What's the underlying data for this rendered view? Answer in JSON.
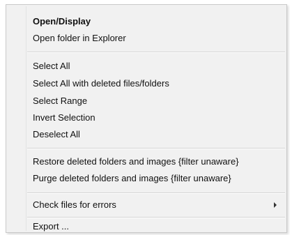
{
  "menu": {
    "items": [
      {
        "label": "Open/Display"
      },
      {
        "label": "Open folder in Explorer"
      },
      {
        "label": "Select All"
      },
      {
        "label": "Select All with deleted files/folders"
      },
      {
        "label": "Select Range"
      },
      {
        "label": "Invert Selection"
      },
      {
        "label": "Deselect All"
      },
      {
        "label": "Restore deleted folders and images {filter unaware}"
      },
      {
        "label": "Purge deleted folders and images {filter unaware}"
      },
      {
        "label": "Check files for errors",
        "submenu_icon": "chevron-right-icon"
      },
      {
        "label": "Export ..."
      }
    ]
  }
}
